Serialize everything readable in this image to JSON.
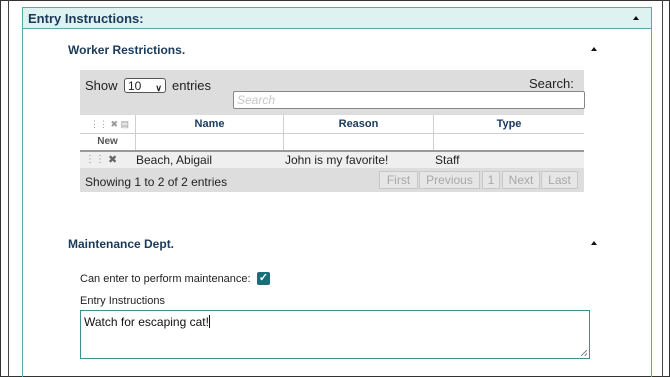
{
  "section": {
    "title": "Entry Instructions:"
  },
  "worker_restrictions": {
    "title": "Worker Restrictions.",
    "show_label": "Show",
    "page_size": "10",
    "entries_label": "entries",
    "search_label": "Search:",
    "search_placeholder": "Search",
    "columns": [
      "Name",
      "Reason",
      "Type"
    ],
    "new_label": "New",
    "rows": [
      {
        "name": "Beach, Abigail",
        "reason": "John is my favorite!",
        "type": "Staff"
      }
    ],
    "info": "Showing 1 to 2 of 2 entries",
    "pagination": {
      "first": "First",
      "previous": "Previous",
      "page": "1",
      "next": "Next",
      "last": "Last"
    }
  },
  "maintenance": {
    "title": "Maintenance Dept.",
    "checkbox_label": "Can enter to perform maintenance:",
    "checkbox_checked": true,
    "entry_label": "Entry Instructions",
    "entry_value": "Watch for escaping cat!"
  },
  "colors": {
    "accent": "#1b6d77",
    "header_bg": "#dff2f2",
    "header_border": "#5aa8ad",
    "title": "#1a3a5a"
  }
}
